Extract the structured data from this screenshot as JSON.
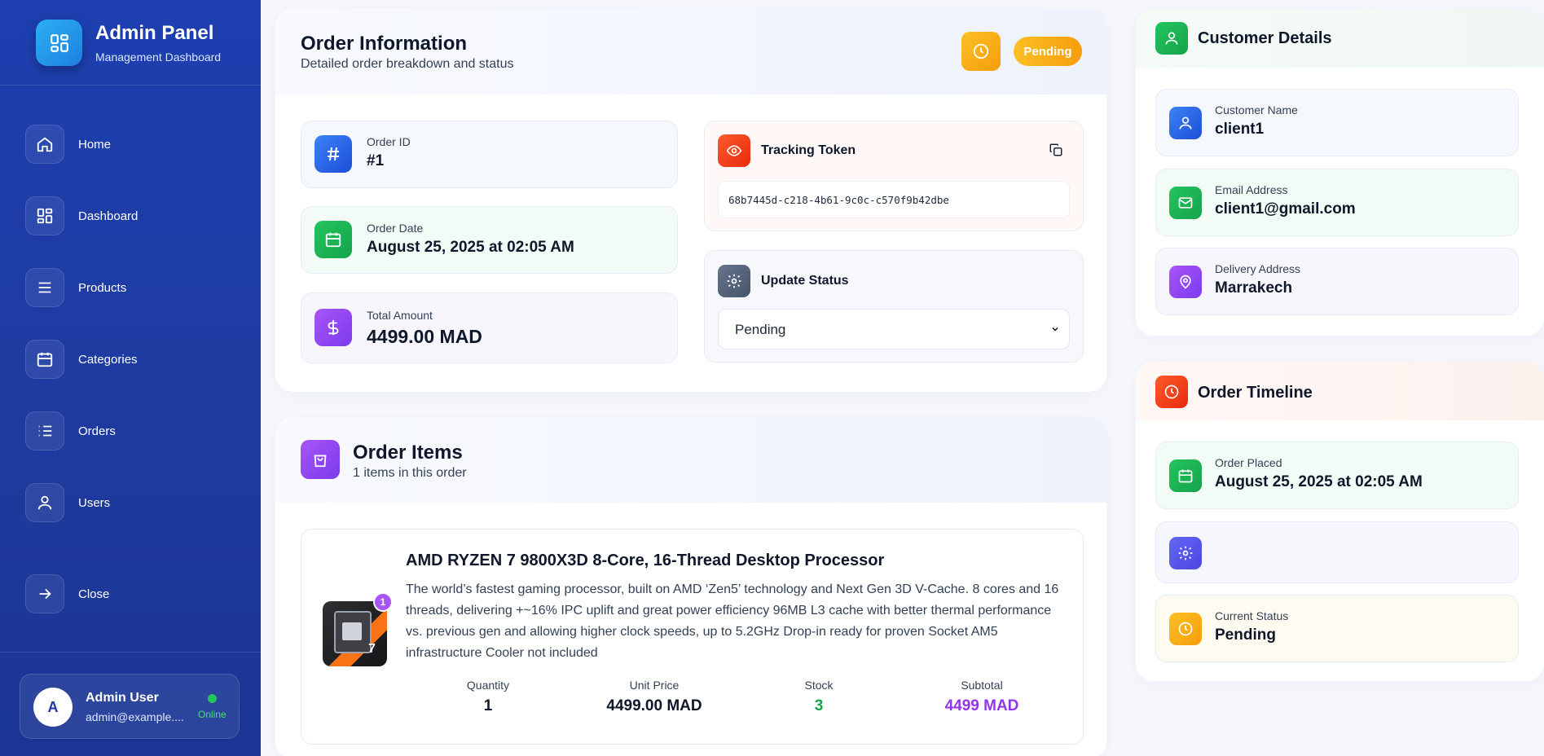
{
  "brand": {
    "title": "Admin Panel",
    "subtitle": "Management Dashboard"
  },
  "nav": [
    {
      "label": "Home",
      "icon": "home-icon"
    },
    {
      "label": "Dashboard",
      "icon": "grid-icon"
    },
    {
      "label": "Products",
      "icon": "list-icon"
    },
    {
      "label": "Categories",
      "icon": "calendar-icon"
    },
    {
      "label": "Orders",
      "icon": "ordered-list-icon"
    },
    {
      "label": "Users",
      "icon": "user-icon"
    },
    {
      "label": "Close",
      "icon": "arrow-right-icon"
    }
  ],
  "user": {
    "initial": "A",
    "name": "Admin User",
    "email": "admin@example....",
    "status": "Online"
  },
  "order_info": {
    "title": "Order Information",
    "subtitle": "Detailed order breakdown and status",
    "status_badge": "Pending",
    "order_id_label": "Order ID",
    "order_id": "#1",
    "order_date_label": "Order Date",
    "order_date": "August 25, 2025 at 02:05 AM",
    "total_label": "Total Amount",
    "total": "4499.00 MAD",
    "tracking_label": "Tracking Token",
    "tracking_token": "68b7445d-c218-4b61-9c0c-c570f9b42dbe",
    "update_status_label": "Update Status",
    "status_value": "Pending"
  },
  "order_items": {
    "title": "Order Items",
    "subtitle": "1 items in this order",
    "items": [
      {
        "name": "AMD RYZEN 7 9800X3D 8-Core, 16-Thread Desktop Processor",
        "qty_badge": "1",
        "description": "The world’s fastest gaming processor, built on AMD ‘Zen5’ technology and Next Gen 3D V-Cache. 8 cores and 16 threads, delivering +~16% IPC uplift and great power efficiency 96MB L3 cache with better thermal performance vs. previous gen and allowing higher clock speeds, up to 5.2GHz Drop-in ready for proven Socket AM5 infrastructure Cooler not included",
        "quantity_label": "Quantity",
        "quantity": "1",
        "unit_price_label": "Unit Price",
        "unit_price": "4499.00 MAD",
        "stock_label": "Stock",
        "stock": "3",
        "subtotal_label": "Subtotal",
        "subtotal": "4499 MAD"
      }
    ]
  },
  "customer": {
    "title": "Customer Details",
    "name_label": "Customer Name",
    "name": "client1",
    "email_label": "Email Address",
    "email": "client1@gmail.com",
    "address_label": "Delivery Address",
    "address": "Marrakech"
  },
  "timeline": {
    "title": "Order Timeline",
    "placed_label": "Order Placed",
    "placed": "August 25, 2025 at 02:05 AM",
    "current_label": "Current Status",
    "current": "Pending"
  },
  "colors": {
    "sidebar": "#1e3a9e",
    "accent_orange": "#f59e0b",
    "stock_green": "#16a34a",
    "subtotal_purple": "#9333ea"
  }
}
